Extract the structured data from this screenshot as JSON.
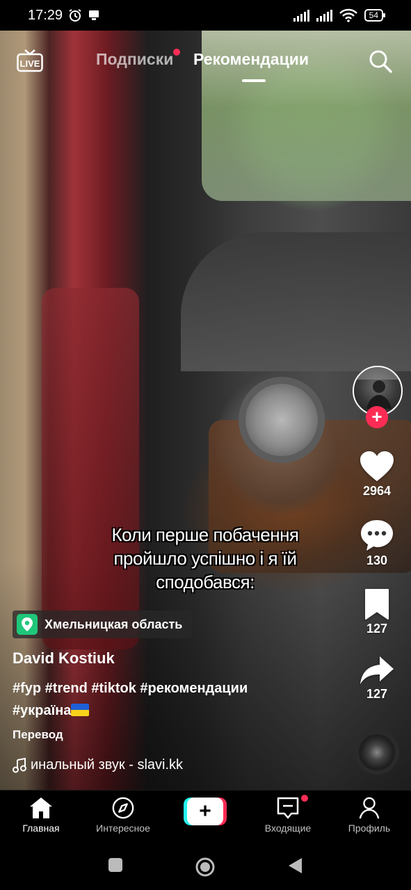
{
  "status_bar": {
    "time": "17:29",
    "battery": "54"
  },
  "top_nav": {
    "live_label": "LIVE",
    "tabs": [
      {
        "label": "Подписки",
        "has_dot": true
      },
      {
        "label": "Рекомендации",
        "active": true
      }
    ]
  },
  "caption": {
    "line1": "Коли перше побачення",
    "line2": "пройшло успішно і я їй",
    "line3": "сподобався:"
  },
  "rail": {
    "likes": "2964",
    "comments": "130",
    "saves": "127",
    "shares": "127"
  },
  "post": {
    "location": "Хмельницкая область",
    "author": "David Kostiuk",
    "hashtags_line1": "#fyp #trend #tiktok #рекомендации",
    "hashtags_line2": "#україна",
    "translate": "Перевод",
    "sound": "инальный звук - slavi.kk"
  },
  "bottom_tabs": [
    {
      "label": "Главная",
      "icon": "home-icon",
      "active": true
    },
    {
      "label": "Интересное",
      "icon": "compass-icon"
    },
    {
      "label": "",
      "icon": "plus-icon"
    },
    {
      "label": "Входящие",
      "icon": "inbox-icon",
      "has_dot": true
    },
    {
      "label": "Профиль",
      "icon": "profile-icon"
    }
  ],
  "colors": {
    "accent_red": "#fe2c55",
    "accent_cyan": "#25f4ee",
    "location_green": "#1fc77a"
  }
}
